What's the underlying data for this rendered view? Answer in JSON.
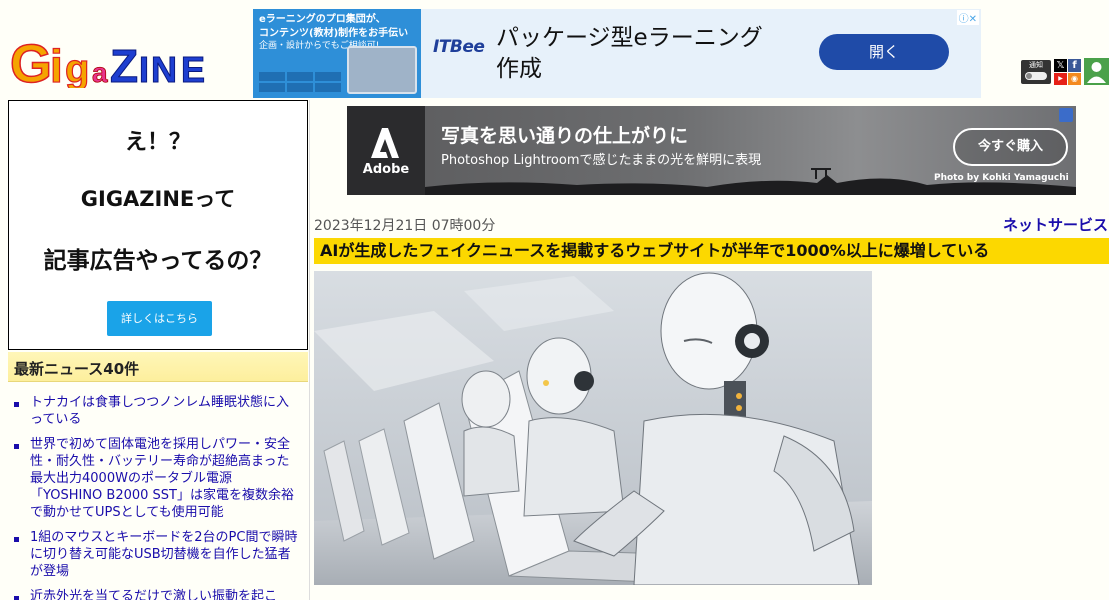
{
  "header": {
    "logo_text": "GigaZINE",
    "logo_letters": [
      "G",
      "i",
      "g",
      "a",
      "Z",
      "I",
      "N",
      "E"
    ]
  },
  "top_ad": {
    "left_line1": "eラーニングのプロ集団が、",
    "left_line2": "コンテンツ(教材)制作をお手伝い",
    "left_line3": "企画・設計からでもご相談可!",
    "brand": "ITBee",
    "headline_line1": "パッケージ型eラーニング",
    "headline_line2": "作成",
    "button_label": "開く",
    "adchoice": "ⓘ✕"
  },
  "header_icons": {
    "notify_label": "通知",
    "notify_state": "OFF",
    "x_glyph": "𝕏",
    "fb_glyph": "f",
    "yt_glyph": "▶",
    "rss_glyph": "◉"
  },
  "promo": {
    "line1": "え！？",
    "line2": "GIGAZINEって",
    "line3": "記事広告やってるの？",
    "button_label": "詳しくはこちら"
  },
  "news": {
    "header": "最新ニュース40件",
    "items": [
      "トナカイは食事しつつノンレム睡眠状態に入っている",
      "世界で初めて固体電池を採用しパワー・安全性・耐久性・バッテリー寿命が超絶高まった最大出力4000Wのポータブル電源「YOSHINO B2000 SST」は家電を複数余裕で動かせてUPSとしても使用可能",
      "1組のマウスとキーボードを2台のPC間で瞬時に切り替え可能なUSB切替機を自作した猛者が登場",
      "近赤外光を当てるだけで激しい振動を起こ"
    ]
  },
  "adobe_ad": {
    "brand": "Adobe",
    "headline": "写真を思い通りの仕上がりに",
    "subline": "Photoshop Lightroomで感じたままの光を鮮明に表現",
    "button_label": "今すぐ購入",
    "credit": "Photo by Kohki Yamaguchi"
  },
  "article": {
    "date": "2023年12月21日 07時00分",
    "category": "ネットサービス",
    "title": "AIが生成したフェイクニュースを掲載するウェブサイトが半年で1000%以上に爆増している"
  }
}
